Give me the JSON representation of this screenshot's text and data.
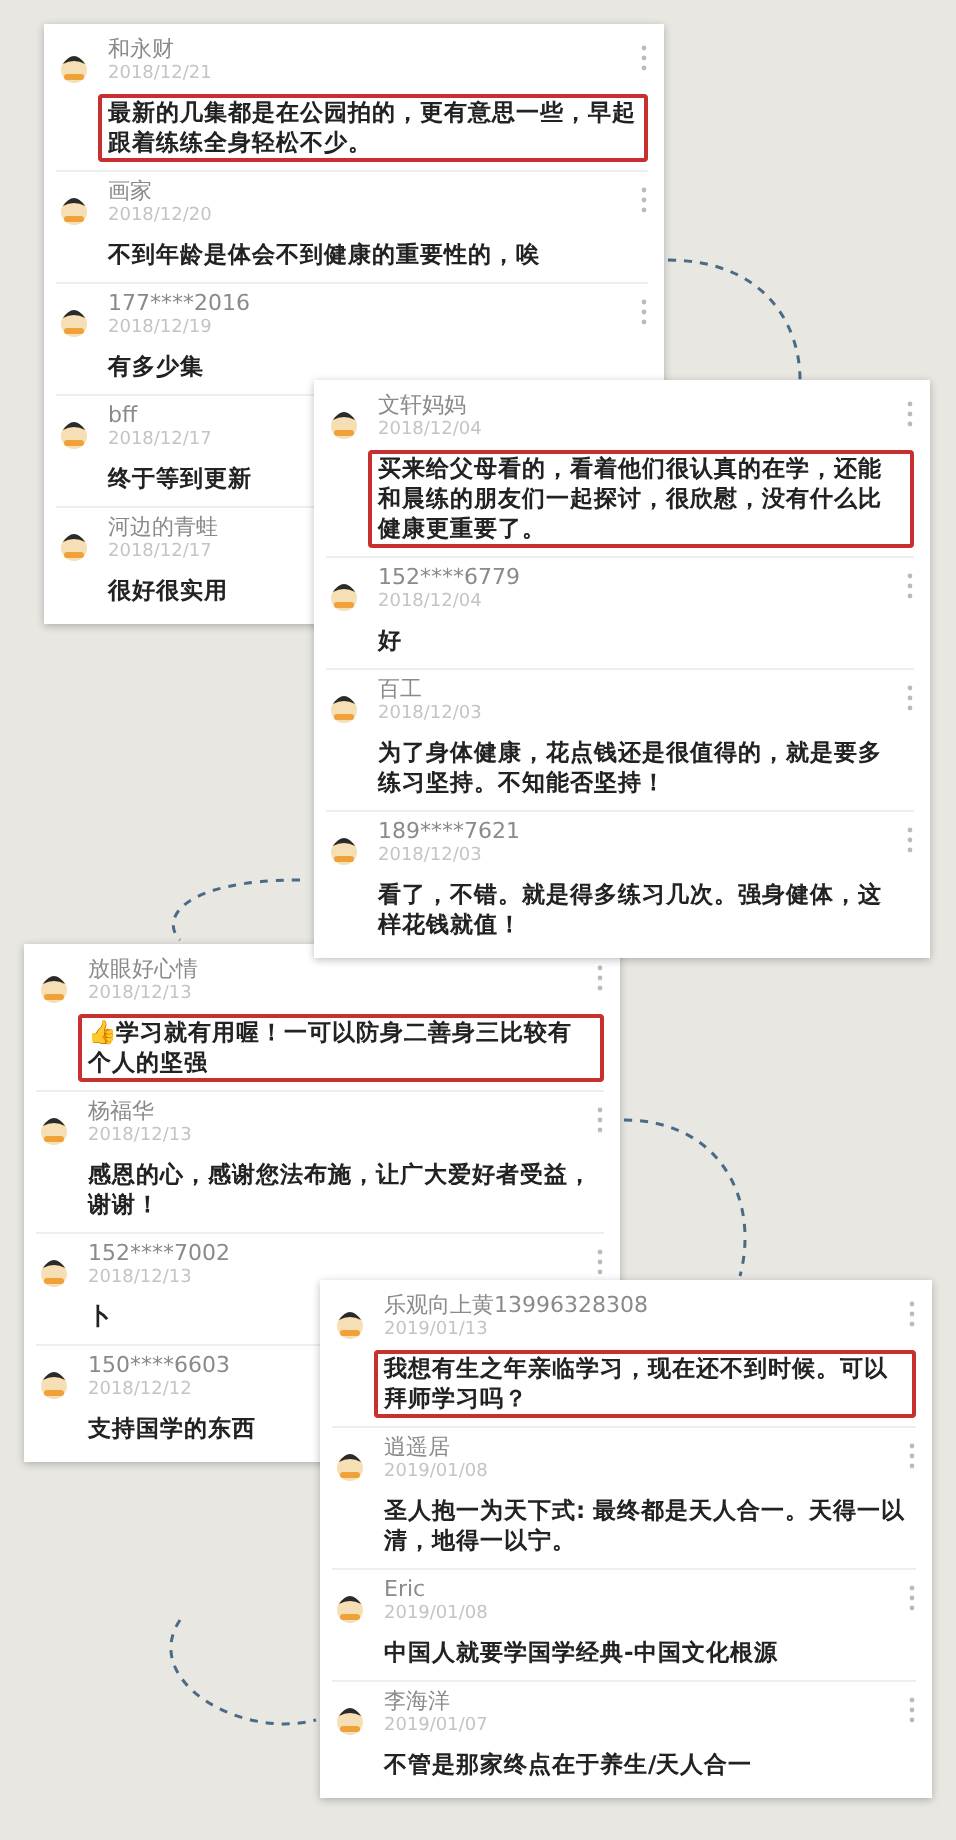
{
  "cards": [
    {
      "comments": [
        {
          "name": "和永财",
          "date": "2018/12/21",
          "text": "最新的几集都是在公园拍的，更有意思一些，早起跟着练练全身轻松不少。",
          "highlighted": true
        },
        {
          "name": "画家",
          "date": "2018/12/20",
          "text": "不到年龄是体会不到健康的重要性的，唉",
          "highlighted": false
        },
        {
          "name": "177****2016",
          "date": "2018/12/19",
          "text": "有多少集",
          "highlighted": false
        },
        {
          "name": "bff",
          "date": "2018/12/17",
          "text": "终于等到更新",
          "highlighted": false
        },
        {
          "name": "河边的青蛙",
          "date": "2018/12/17",
          "text": "很好很实用",
          "highlighted": false
        }
      ]
    },
    {
      "comments": [
        {
          "name": "文轩妈妈",
          "date": "2018/12/04",
          "text": "买来给父母看的，看着他们很认真的在学，还能和晨练的朋友们一起探讨，很欣慰，没有什么比健康更重要了。",
          "highlighted": true
        },
        {
          "name": "152****6779",
          "date": "2018/12/04",
          "text": "好",
          "highlighted": false
        },
        {
          "name": "百工",
          "date": "2018/12/03",
          "text": "为了身体健康，花点钱还是很值得的，就是要多练习坚持。不知能否坚持！",
          "highlighted": false
        },
        {
          "name": "189****7621",
          "date": "2018/12/03",
          "text": "看了，不错。就是得多练习几次。强身健体，这样花钱就值！",
          "highlighted": false
        }
      ]
    },
    {
      "comments": [
        {
          "name": "放眼好心情",
          "date": "2018/12/13",
          "text": "👍学习就有用喔！一可以防身二善身三比较有个人的坚强",
          "highlighted": true
        },
        {
          "name": "杨福华",
          "date": "2018/12/13",
          "text": "感恩的心，感谢您法布施，让广大爱好者受益，谢谢！",
          "highlighted": false
        },
        {
          "name": "152****7002",
          "date": "2018/12/13",
          "text": "卜",
          "highlighted": false
        },
        {
          "name": "150****6603",
          "date": "2018/12/12",
          "text": "支持国学的东西",
          "highlighted": false
        }
      ]
    },
    {
      "comments": [
        {
          "name": "乐观向上黄13996328308",
          "date": "2019/01/13",
          "text": "我想有生之年亲临学习，现在还不到时候。可以拜师学习吗？",
          "highlighted": true
        },
        {
          "name": "逍遥居",
          "date": "2019/01/08",
          "text": "圣人抱一为天下式: 最终都是天人合一。天得一以清，地得一以宁。",
          "highlighted": false
        },
        {
          "name": "Eric",
          "date": "2019/01/08",
          "text": "中国人就要学国学经典-中国文化根源",
          "highlighted": false
        },
        {
          "name": "李海洋",
          "date": "2019/01/07",
          "text": "不管是那家终点在于养生/天人合一",
          "highlighted": false
        }
      ]
    }
  ]
}
